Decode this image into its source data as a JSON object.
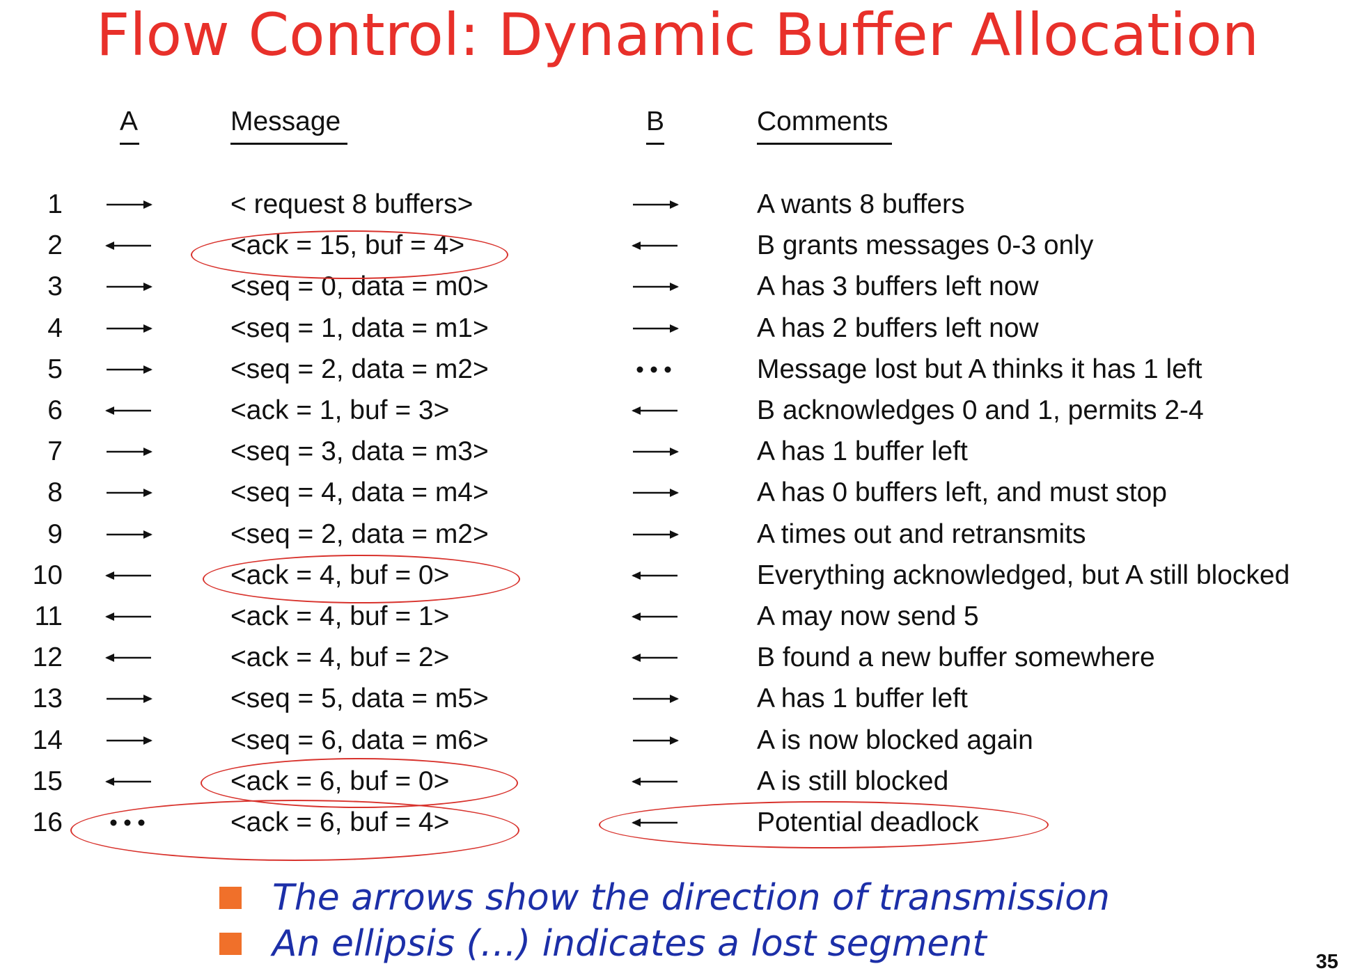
{
  "slide": {
    "title": "Flow Control: Dynamic Buffer Allocation",
    "page_number": "35"
  },
  "table": {
    "headers": {
      "a": "A",
      "message": "Message",
      "b": "B",
      "comments": "Comments"
    },
    "rows": [
      {
        "n": "1",
        "a": "right",
        "msg": "< request 8 buffers>",
        "b": "right",
        "cmt": "A wants 8 buffers"
      },
      {
        "n": "2",
        "a": "left",
        "msg": "<ack = 15, buf = 4>",
        "b": "left",
        "cmt": "B grants messages 0-3 only"
      },
      {
        "n": "3",
        "a": "right",
        "msg": "<seq = 0, data = m0>",
        "b": "right",
        "cmt": "A has 3 buffers left now"
      },
      {
        "n": "4",
        "a": "right",
        "msg": "<seq = 1, data = m1>",
        "b": "right",
        "cmt": "A has 2 buffers left now"
      },
      {
        "n": "5",
        "a": "right",
        "msg": "<seq = 2, data = m2>",
        "b": "ellipsis",
        "cmt": "Message lost but A thinks it has 1 left"
      },
      {
        "n": "6",
        "a": "left",
        "msg": "<ack = 1, buf = 3>",
        "b": "left",
        "cmt": "B acknowledges 0 and 1, permits 2-4"
      },
      {
        "n": "7",
        "a": "right",
        "msg": "<seq = 3, data = m3>",
        "b": "right",
        "cmt": "A has 1 buffer left"
      },
      {
        "n": "8",
        "a": "right",
        "msg": "<seq = 4, data = m4>",
        "b": "right",
        "cmt": "A has 0 buffers left, and must stop"
      },
      {
        "n": "9",
        "a": "right",
        "msg": "<seq = 2, data = m2>",
        "b": "right",
        "cmt": "A times out and retransmits"
      },
      {
        "n": "10",
        "a": "left",
        "msg": "<ack = 4, buf = 0>",
        "b": "left",
        "cmt": "Everything acknowledged, but A still blocked"
      },
      {
        "n": "11",
        "a": "left",
        "msg": "<ack = 4, buf = 1>",
        "b": "left",
        "cmt": "A may now send 5"
      },
      {
        "n": "12",
        "a": "left",
        "msg": "<ack = 4, buf = 2>",
        "b": "left",
        "cmt": "B found a new buffer somewhere"
      },
      {
        "n": "13",
        "a": "right",
        "msg": "<seq = 5, data = m5>",
        "b": "right",
        "cmt": "A has 1 buffer left"
      },
      {
        "n": "14",
        "a": "right",
        "msg": "<seq = 6, data = m6>",
        "b": "right",
        "cmt": "A is now blocked again"
      },
      {
        "n": "15",
        "a": "left",
        "msg": "<ack = 6, buf = 0>",
        "b": "left",
        "cmt": "A is still blocked"
      },
      {
        "n": "16",
        "a": "ellipsis",
        "msg": "<ack = 6, buf = 4>",
        "b": "left",
        "cmt": "Potential deadlock"
      }
    ]
  },
  "bullets": [
    "The arrows show the direction of transmission",
    "An ellipsis (…) indicates a lost segment"
  ],
  "colors": {
    "title": "#e8302a",
    "highlight": "#d8322c",
    "bullet_text": "#1c2fa8",
    "bullet_marker": "#f0702a"
  }
}
